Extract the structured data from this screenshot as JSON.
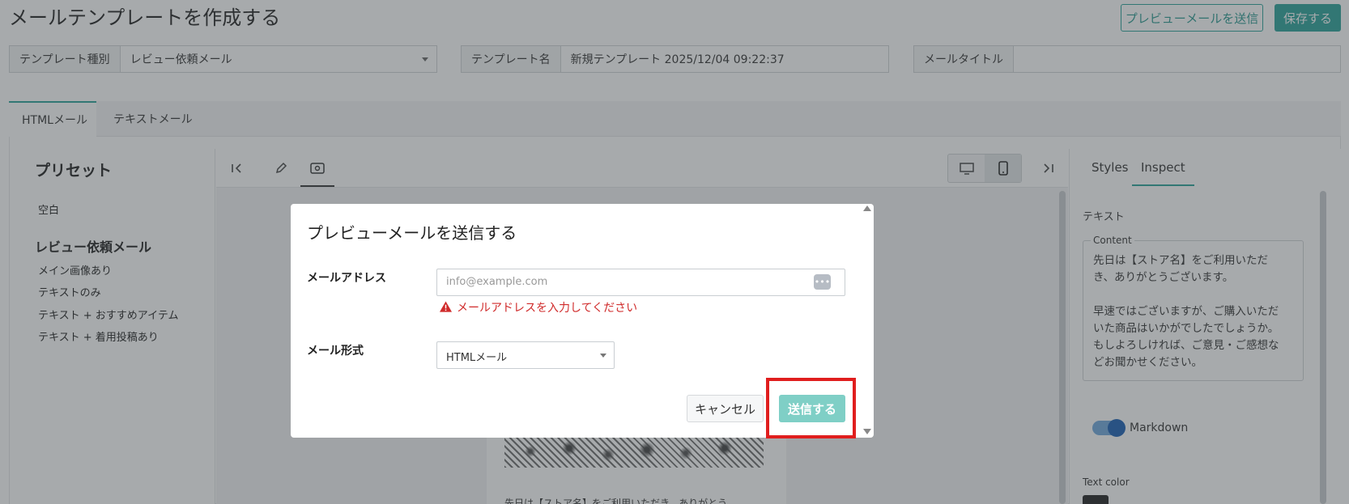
{
  "header": {
    "title": "メールテンプレートを作成する",
    "send_preview_label": "プレビューメールを送信",
    "save_label": "保存する"
  },
  "fields": {
    "template_type": {
      "label": "テンプレート種別",
      "value": "レビュー依頼メール"
    },
    "template_name": {
      "label": "テンプレート名",
      "value": "新規テンプレート 2025/12/04 09:22:37"
    },
    "mail_title": {
      "label": "メールタイトル",
      "value": ""
    }
  },
  "tabs": [
    {
      "label": "HTMLメール",
      "active": true
    },
    {
      "label": "テキストメール",
      "active": false
    }
  ],
  "presets": {
    "title": "プリセット",
    "blank": "空白",
    "group_title": "レビュー依頼メール",
    "items": [
      "メイン画像あり",
      "テキストのみ",
      "テキスト + おすすめアイテム",
      "テキスト + 着用投稿あり"
    ]
  },
  "toolbar": {
    "icons": [
      "collapse-left-icon",
      "pencil-icon",
      "preview-eye-icon",
      "desktop-icon",
      "mobile-icon",
      "collapse-right-icon"
    ],
    "active_view": "mobile"
  },
  "preview": {
    "text": "先日は【ストア名】をご利用いただき、ありがとう"
  },
  "right_panel": {
    "tabs": [
      "Styles",
      "Inspect"
    ],
    "active_tab": "Inspect",
    "section": "テキスト",
    "content_label": "Content",
    "content_text": "先日は【ストア名】をご利用いただき、ありがとうございます。\n\n早速ではございますが、ご購入いただいた商品はいかがでしたでしょうか。もしよろしければ、ご意見・ご感想などお聞かせください。",
    "markdown_label": "Markdown",
    "markdown_on": true,
    "text_color_label": "Text color",
    "text_color": "#222222"
  },
  "modal": {
    "title": "プレビューメールを送信する",
    "email_label": "メールアドレス",
    "email_placeholder": "info@example.com",
    "email_value": "",
    "error": "メールアドレスを入力してください",
    "format_label": "メール形式",
    "format_value": "HTMLメール",
    "cancel_label": "キャンセル",
    "send_label": "送信する"
  },
  "colors": {
    "accent": "#2aa39a",
    "send_disabled": "#7fcfc6",
    "error": "#d02b2b",
    "highlight": "#e01e1e"
  }
}
